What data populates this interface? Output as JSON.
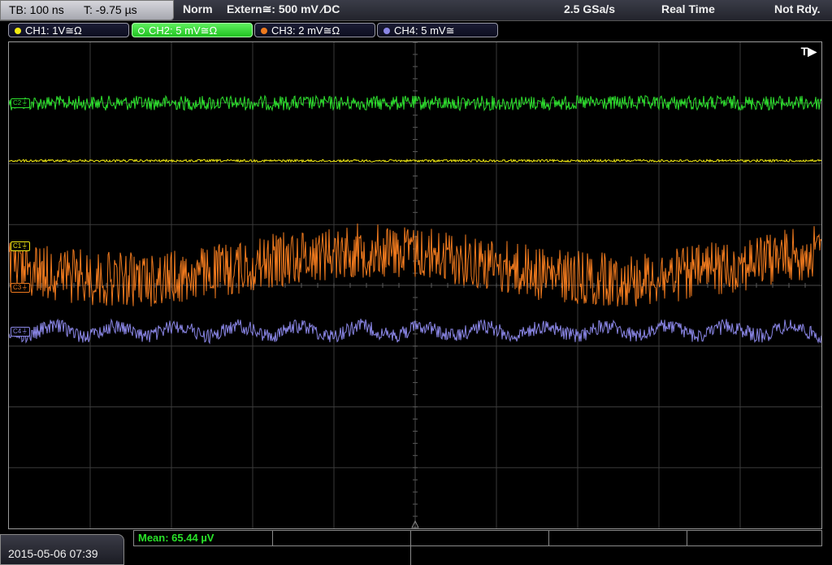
{
  "topbar": {
    "timebase": "TB: 100 ns",
    "trigger_time": "T: -9.75 µs",
    "mode": "Norm",
    "trigger_source": "Extern≅: 500 mV ⁄DC",
    "sample_rate": "2.5 GSa/s",
    "acq_mode": "Real Time",
    "state": "Not Rdy."
  },
  "channels": [
    {
      "label": "CH1: 1V≅Ω",
      "color": "#f2ea12",
      "active": false
    },
    {
      "label": "CH2: 5 mV≅Ω",
      "color": "#2ee12e",
      "active": true
    },
    {
      "label": "CH3: 2 mV≅Ω",
      "color": "#f07a1e",
      "active": false
    },
    {
      "label": "CH4: 5 mV≅",
      "color": "#8a86e6",
      "active": false
    }
  ],
  "screen": {
    "trigger_label": "T▶",
    "markers": {
      "c1": "C1⏚",
      "c3": "C3⏚",
      "c4": "C4⏚",
      "c2": "C2⏚"
    }
  },
  "traces": {
    "ch1": {
      "color": "#f2ea12",
      "level_div": 1.95,
      "noise_div": 0.02
    },
    "ch2": {
      "color": "#2ee12e",
      "level_div": 1.0,
      "noise_div": 0.12
    },
    "ch3": {
      "color": "#f07a1e",
      "level_div": 3.8,
      "noise_div": 0.45
    },
    "ch4": {
      "color": "#8a86e6",
      "level_div": 4.75,
      "noise_div": 0.12
    }
  },
  "measurement": {
    "mean": "Mean: 65.44 µV"
  },
  "datetime": "2015-05-06 07:39"
}
